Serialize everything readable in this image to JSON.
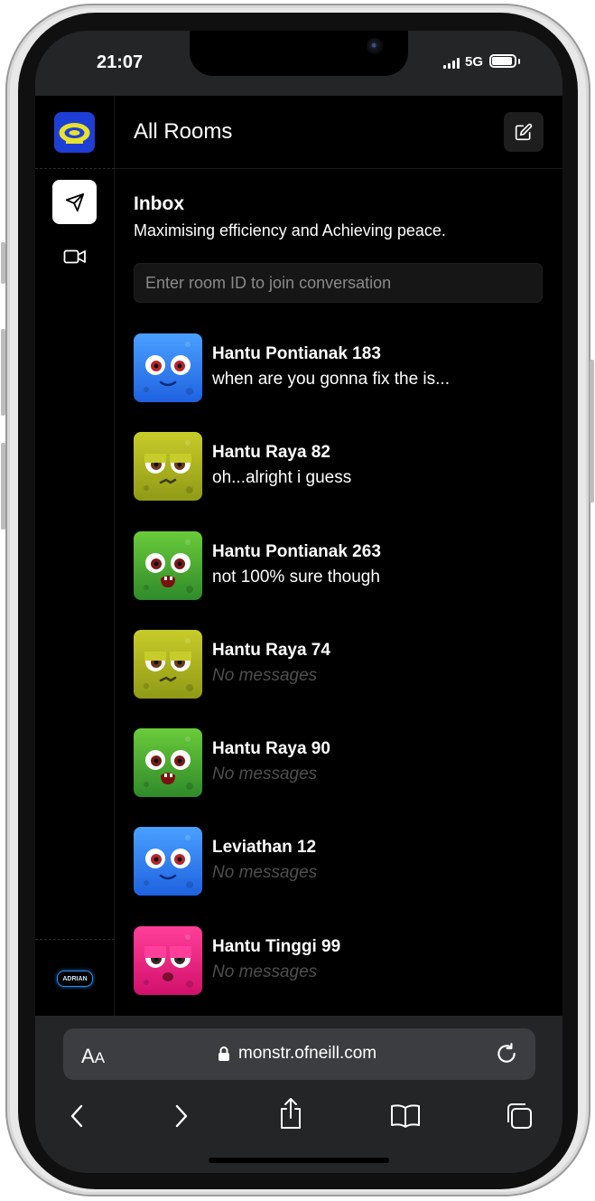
{
  "status_bar": {
    "time": "21:07",
    "network": "5G"
  },
  "sidebar": {
    "user_badge": "ADRIAN"
  },
  "header": {
    "title": "All Rooms"
  },
  "inbox": {
    "title": "Inbox",
    "subtitle": "Maximising efficiency and Achieving peace.",
    "room_input_placeholder": "Enter room ID to join conversation"
  },
  "rooms": [
    {
      "name": "Hantu Pontianak 183",
      "last_message": "when are you gonna fix the is...",
      "avatar": "blue-monster"
    },
    {
      "name": "Hantu Raya 82",
      "last_message": "oh...alright i guess",
      "avatar": "yellow-monster"
    },
    {
      "name": "Hantu Pontianak 263",
      "last_message": "not 100% sure though",
      "avatar": "green-monster"
    },
    {
      "name": "Hantu Raya 74",
      "last_message": "No messages",
      "avatar": "yellow-monster"
    },
    {
      "name": "Hantu Raya 90",
      "last_message": "No messages",
      "avatar": "green-monster"
    },
    {
      "name": "Leviathan 12",
      "last_message": "No messages",
      "avatar": "blue-monster"
    },
    {
      "name": "Hantu Tinggi 99",
      "last_message": "No messages",
      "avatar": "pink-monster"
    }
  ],
  "browser": {
    "text_size_label": "A",
    "text_size_label_small": "A",
    "url": "monstr.ofneill.com"
  },
  "colors": {
    "background": "#000000",
    "chrome": "#232527",
    "logo_blue": "#1d3fd6",
    "logo_yellow": "#e8e22a",
    "muted_text": "#4f4f4f"
  }
}
